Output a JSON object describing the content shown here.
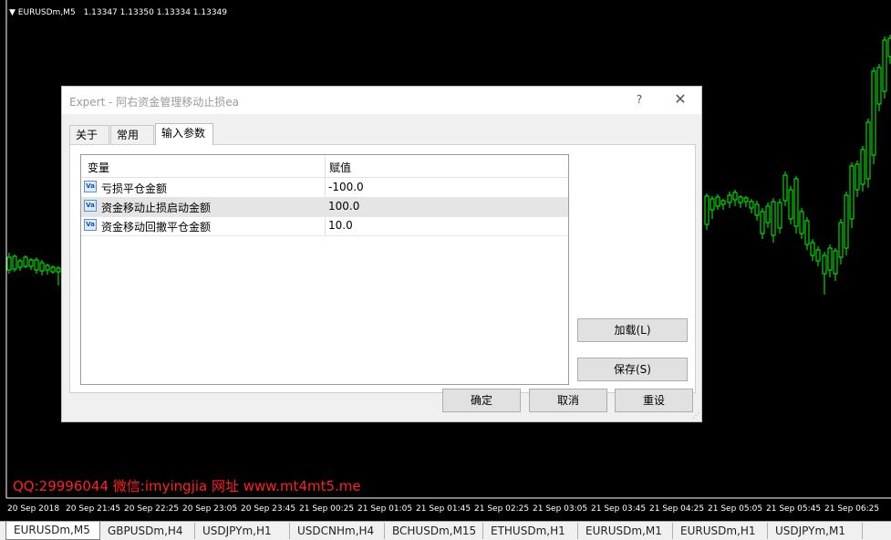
{
  "chart": {
    "symbol": "EURUSDm,M5",
    "ohlc": "1.13347 1.13350 1.13334 1.13349",
    "watermark": "QQ:29996044 微信:imyingjia 网址 www.mt4mt5.me",
    "time_labels": [
      "20 Sep 2018",
      "20 Sep 21:45",
      "20 Sep 22:25",
      "20 Sep 23:05",
      "20 Sep 23:45",
      "21 Sep 00:25",
      "21 Sep 01:05",
      "21 Sep 01:45",
      "21 Sep 02:25",
      "21 Sep 03:05",
      "21 Sep 03:45",
      "21 Sep 04:25",
      "21 Sep 05:05",
      "21 Sep 05:45",
      "21 Sep 06:25"
    ],
    "colors": {
      "background": "#000000",
      "candle": "#00ff00",
      "watermark": "#ff2020"
    }
  },
  "chart_tabs": [
    "EURUSDm,M5",
    "GBPUSDm,H4",
    "USDJPYm,H1",
    "USDCNHm,H4",
    "BCHUSDm,M15",
    "ETHUSDm,H1",
    "EURUSDm,M1",
    "EURUSDm,H1",
    "USDJPYm,M1"
  ],
  "dialog": {
    "title": "Expert - 阿右资金管理移动止损ea",
    "help_label": "?",
    "close_label": "✕",
    "tabs": [
      "关于",
      "常用",
      "输入参数"
    ],
    "active_tab": 2,
    "grid": {
      "col_variable": "变量",
      "col_value": "赋值",
      "icon_text": "Va",
      "rows": [
        {
          "name": "亏损平仓金额",
          "value": "-100.0"
        },
        {
          "name": "资金移动止损启动金额",
          "value": "100.0"
        },
        {
          "name": "资金移动回撤平仓金额",
          "value": "10.0"
        }
      ]
    },
    "load_button": "加载(L)",
    "save_button": "保存(S)",
    "ok_button": "确定",
    "cancel_button": "取消",
    "reset_button": "重设"
  }
}
